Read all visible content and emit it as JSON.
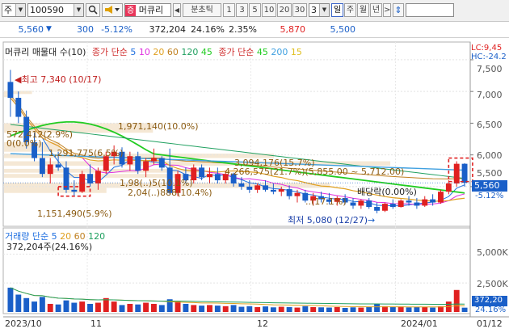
{
  "toolbar": {
    "market": "주",
    "code": "100590",
    "name": "머큐리",
    "name_tag": "증",
    "interval_label": "분초틱",
    "intervals": [
      "1",
      "3",
      "5",
      "10",
      "20",
      "30"
    ],
    "interval_input": "3",
    "period_day": "일",
    "periods": [
      "주",
      "월",
      "년"
    ]
  },
  "quote": {
    "price": "5,560",
    "change": "300",
    "change_pct": "-5.12%",
    "volume": "372,204",
    "turnover": "24.16%",
    "ratio": "2.35%",
    "high": "5,870",
    "low": "5,500"
  },
  "legend": {
    "indicator": "머큐리 매물대 수(10)",
    "ma_group1_label": "종가 단순",
    "ma_group1": [
      "5",
      "10",
      "20",
      "60",
      "120",
      "45"
    ],
    "ma_group2_label": "종가 단순",
    "ma_group2": [
      "45",
      "200",
      "15"
    ],
    "volume_label": "거래량 단순",
    "volume_periods": [
      "5",
      "20",
      "60",
      "120"
    ],
    "volume_value": "372,204주(24.16%)"
  },
  "annotations": {
    "high_mark": "최고 7,340 (10/17)",
    "low_mark": "최저 5,080 (12/27)",
    "dividend": "배당락(0.00%)"
  },
  "volume_profile_labels": [
    {
      "text": "572,412(2.9%)"
    },
    {
      "text": "0(0.0%)"
    },
    {
      "text": "1,291,775(6.5%)"
    },
    {
      "text": "1,971,140(10.0%)"
    },
    {
      "text": "3,094,176(15.7%)"
    },
    {
      "text": "4,266,575(21.7%)(5,855.00 ~ 5,712.00)"
    },
    {
      "text": "1,98(..)5(10.1%)"
    },
    {
      "text": "2,04(..)888(10.4%)"
    },
    {
      "text": "..(17.1%)"
    },
    {
      "text": "1,151,490(5.9%)"
    }
  ],
  "price_axis": {
    "labels": [
      "7,500",
      "7,000",
      "6,500",
      "6,000",
      "5,500"
    ],
    "current": "5,560",
    "current_change": "-5.12%",
    "lc": "LC:9,45",
    "hc": "HC:-24.2"
  },
  "volume_axis": {
    "labels": [
      "5,000K",
      "2,500K"
    ],
    "current": "372,20",
    "current_pct": "24.16%"
  },
  "time_axis": {
    "labels": [
      "2023/10",
      "11",
      "12",
      "2024/01",
      "01/12"
    ]
  },
  "chart_data": {
    "type": "candlestick",
    "price_range": [
      4900,
      7550
    ],
    "volume_range": [
      0,
      6000000
    ],
    "candles": [
      {
        "o": 7150,
        "h": 7340,
        "l": 6600,
        "c": 6900
      },
      {
        "o": 6900,
        "h": 7000,
        "l": 6500,
        "c": 6600
      },
      {
        "o": 6600,
        "h": 6700,
        "l": 6100,
        "c": 6200
      },
      {
        "o": 6200,
        "h": 6350,
        "l": 5900,
        "c": 5950
      },
      {
        "o": 5950,
        "h": 6200,
        "l": 5650,
        "c": 5700
      },
      {
        "o": 5700,
        "h": 5950,
        "l": 5550,
        "c": 5850
      },
      {
        "o": 5850,
        "h": 6050,
        "l": 5750,
        "c": 5800
      },
      {
        "o": 5800,
        "h": 5900,
        "l": 5400,
        "c": 5450
      },
      {
        "o": 5450,
        "h": 5600,
        "l": 5350,
        "c": 5420
      },
      {
        "o": 5420,
        "h": 5750,
        "l": 5400,
        "c": 5700
      },
      {
        "o": 5700,
        "h": 5850,
        "l": 5500,
        "c": 5550
      },
      {
        "o": 5550,
        "h": 5800,
        "l": 5450,
        "c": 5750
      },
      {
        "o": 5750,
        "h": 6050,
        "l": 5700,
        "c": 5980
      },
      {
        "o": 5980,
        "h": 6150,
        "l": 5850,
        "c": 6050
      },
      {
        "o": 6050,
        "h": 6120,
        "l": 5800,
        "c": 5850
      },
      {
        "o": 5850,
        "h": 6050,
        "l": 5750,
        "c": 5980
      },
      {
        "o": 5980,
        "h": 6050,
        "l": 5700,
        "c": 5750
      },
      {
        "o": 5750,
        "h": 5950,
        "l": 5650,
        "c": 5900
      },
      {
        "o": 5900,
        "h": 6100,
        "l": 5850,
        "c": 5950
      },
      {
        "o": 5950,
        "h": 5980,
        "l": 5750,
        "c": 5800
      },
      {
        "o": 5800,
        "h": 6100,
        "l": 5380,
        "c": 5400
      },
      {
        "o": 5400,
        "h": 5750,
        "l": 5350,
        "c": 5700
      },
      {
        "o": 5700,
        "h": 5800,
        "l": 5550,
        "c": 5600
      },
      {
        "o": 5600,
        "h": 5850,
        "l": 5550,
        "c": 5800
      },
      {
        "o": 5800,
        "h": 5850,
        "l": 5600,
        "c": 5650
      },
      {
        "o": 5650,
        "h": 5800,
        "l": 5550,
        "c": 5700
      },
      {
        "o": 5700,
        "h": 5800,
        "l": 5550,
        "c": 5600
      },
      {
        "o": 5600,
        "h": 5750,
        "l": 5550,
        "c": 5700
      },
      {
        "o": 5700,
        "h": 5720,
        "l": 5500,
        "c": 5550
      },
      {
        "o": 5550,
        "h": 5650,
        "l": 5450,
        "c": 5500
      },
      {
        "o": 5500,
        "h": 5600,
        "l": 5400,
        "c": 5450
      },
      {
        "o": 5450,
        "h": 5550,
        "l": 5400,
        "c": 5520
      },
      {
        "o": 5520,
        "h": 5600,
        "l": 5420,
        "c": 5450
      },
      {
        "o": 5450,
        "h": 5550,
        "l": 5380,
        "c": 5420
      },
      {
        "o": 5420,
        "h": 5500,
        "l": 5350,
        "c": 5460
      },
      {
        "o": 5460,
        "h": 5520,
        "l": 5300,
        "c": 5350
      },
      {
        "o": 5350,
        "h": 5450,
        "l": 5250,
        "c": 5400
      },
      {
        "o": 5400,
        "h": 5450,
        "l": 5250,
        "c": 5280
      },
      {
        "o": 5280,
        "h": 5400,
        "l": 5200,
        "c": 5350
      },
      {
        "o": 5350,
        "h": 5420,
        "l": 5250,
        "c": 5300
      },
      {
        "o": 5300,
        "h": 5400,
        "l": 5220,
        "c": 5260
      },
      {
        "o": 5260,
        "h": 5350,
        "l": 5200,
        "c": 5320
      },
      {
        "o": 5320,
        "h": 5380,
        "l": 5220,
        "c": 5250
      },
      {
        "o": 5250,
        "h": 5320,
        "l": 5150,
        "c": 5200
      },
      {
        "o": 5200,
        "h": 5300,
        "l": 5150,
        "c": 5280
      },
      {
        "o": 5280,
        "h": 5320,
        "l": 5150,
        "c": 5180
      },
      {
        "o": 5180,
        "h": 5250,
        "l": 5080,
        "c": 5120
      },
      {
        "o": 5120,
        "h": 5250,
        "l": 5100,
        "c": 5230
      },
      {
        "o": 5230,
        "h": 5300,
        "l": 5150,
        "c": 5180
      },
      {
        "o": 5180,
        "h": 5300,
        "l": 5170,
        "c": 5280
      },
      {
        "o": 5280,
        "h": 5350,
        "l": 5200,
        "c": 5250
      },
      {
        "o": 5250,
        "h": 5320,
        "l": 5150,
        "c": 5200
      },
      {
        "o": 5200,
        "h": 5350,
        "l": 5180,
        "c": 5300
      },
      {
        "o": 5300,
        "h": 5380,
        "l": 5200,
        "c": 5250
      },
      {
        "o": 5250,
        "h": 5450,
        "l": 5230,
        "c": 5420
      },
      {
        "o": 5420,
        "h": 5600,
        "l": 5380,
        "c": 5550
      },
      {
        "o": 5550,
        "h": 5900,
        "l": 5500,
        "c": 5860
      },
      {
        "o": 5860,
        "h": 5870,
        "l": 5500,
        "c": 5560
      }
    ],
    "volumes": [
      2100000,
      1500000,
      1200000,
      900000,
      1300000,
      700000,
      650000,
      1000000,
      800000,
      900000,
      700000,
      800000,
      1200000,
      900000,
      600000,
      700000,
      650000,
      800000,
      700000,
      600000,
      1100000,
      900000,
      700000,
      600000,
      550000,
      600000,
      550000,
      500000,
      600000,
      450000,
      500000,
      420000,
      480000,
      400000,
      450000,
      420000,
      380000,
      500000,
      420000,
      400000,
      380000,
      420000,
      350000,
      400000,
      380000,
      420000,
      700000,
      500000,
      450000,
      480000,
      400000,
      420000,
      450000,
      380000,
      500000,
      900000,
      1900000,
      372204
    ],
    "ma_lines": [
      "5",
      "10",
      "20",
      "60",
      "120",
      "45",
      "200",
      "15"
    ]
  },
  "colors": {
    "up": "#e02020",
    "down": "#1a5fc8",
    "ma5": "#2070e0",
    "ma20": "#e0a020",
    "ma45": "#22cc22",
    "ma60": "#c08020",
    "ma120": "#20a060",
    "profile": "#f4e6d0"
  }
}
